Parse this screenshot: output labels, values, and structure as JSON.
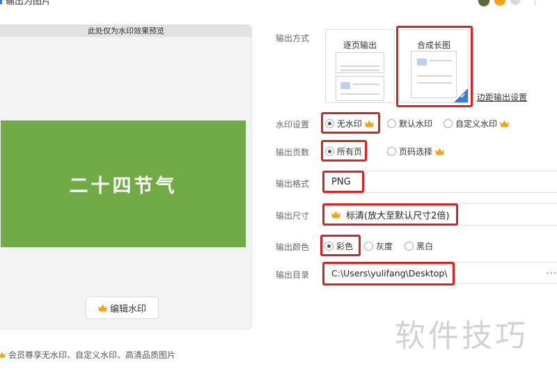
{
  "window": {
    "title": "输出为图片"
  },
  "preview": {
    "header": "此处仅为水印效果预览",
    "canvas_title": "二十四节气",
    "canvas_color": "#71ab45",
    "edit_watermark_label": "编辑水印"
  },
  "footer": {
    "tip": "会员尊享无水印、自定义水印、高清品质图片"
  },
  "settings": {
    "output_mode": {
      "label": "输出方式",
      "options": [
        {
          "label": "逐页输出",
          "selected": false
        },
        {
          "label": "合成长图",
          "selected": true
        }
      ],
      "margin_link": "边距输出设置"
    },
    "watermark": {
      "label": "水印设置",
      "options": [
        {
          "label": "无水印",
          "selected": true,
          "premium": true
        },
        {
          "label": "默认水印",
          "selected": false,
          "premium": false
        },
        {
          "label": "自定义水印",
          "selected": false,
          "premium": true
        }
      ]
    },
    "pages": {
      "label": "输出页数",
      "options": [
        {
          "label": "所有页",
          "selected": true,
          "premium": false
        },
        {
          "label": "页码选择",
          "selected": false,
          "premium": true
        }
      ]
    },
    "format": {
      "label": "输出格式",
      "value": "PNG"
    },
    "size": {
      "label": "输出尺寸",
      "value": "标清(放大至默认尺寸2倍)",
      "premium": true
    },
    "color": {
      "label": "输出颜色",
      "options": [
        {
          "label": "彩色",
          "selected": true
        },
        {
          "label": "灰度",
          "selected": false
        },
        {
          "label": "黑白",
          "selected": false
        }
      ]
    },
    "directory": {
      "label": "输出目录",
      "value": "C:\\Users\\yulifang\\Desktop\\",
      "more": "···"
    }
  },
  "overlay": {
    "site_watermark": "软件技巧"
  },
  "colors": {
    "accent": "#3b7bd8",
    "highlight": "#e0201f",
    "premium": "#f2a21b"
  }
}
